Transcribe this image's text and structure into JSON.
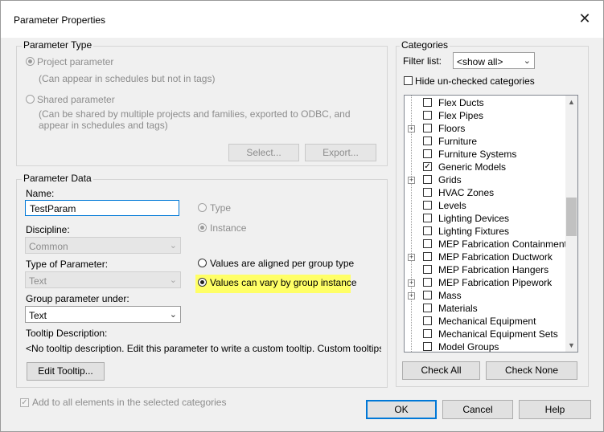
{
  "window": {
    "title": "Parameter Properties",
    "close_glyph": "✕"
  },
  "parameter_type": {
    "legend": "Parameter Type",
    "project_label": "Project parameter",
    "project_desc": "(Can appear in schedules but not in tags)",
    "shared_label": "Shared parameter",
    "shared_desc_1": "(Can be shared by multiple projects and families, exported to ODBC, and",
    "shared_desc_2": "appear in schedules and tags)",
    "select_btn": "Select...",
    "export_btn": "Export..."
  },
  "parameter_data": {
    "legend": "Parameter Data",
    "name_label": "Name:",
    "name_value": "TestParam",
    "discipline_label": "Discipline:",
    "discipline_value": "Common",
    "type_label": "Type of Parameter:",
    "type_value": "Text",
    "group_label": "Group parameter under:",
    "group_value": "Text",
    "radio_type": "Type",
    "radio_instance": "Instance",
    "radio_aligned": "Values are aligned per group type",
    "radio_vary": "Values can vary by group instance",
    "tooltip_label": "Tooltip Description:",
    "tooltip_text": "<No tooltip description. Edit this parameter to write a custom tooltip. Custom tooltips hav...",
    "edit_tooltip_btn": "Edit Tooltip..."
  },
  "add_all_label": "Add to all elements in the selected categories",
  "categories": {
    "legend": "Categories",
    "filter_label": "Filter list:",
    "filter_value": "<show all>",
    "hide_label": "Hide un-checked categories",
    "items": [
      {
        "label": "Flex Ducts",
        "expandable": false,
        "checked": false
      },
      {
        "label": "Flex Pipes",
        "expandable": false,
        "checked": false
      },
      {
        "label": "Floors",
        "expandable": true,
        "checked": false
      },
      {
        "label": "Furniture",
        "expandable": false,
        "checked": false
      },
      {
        "label": "Furniture Systems",
        "expandable": false,
        "checked": false
      },
      {
        "label": "Generic Models",
        "expandable": false,
        "checked": true
      },
      {
        "label": "Grids",
        "expandable": true,
        "checked": false
      },
      {
        "label": "HVAC Zones",
        "expandable": false,
        "checked": false
      },
      {
        "label": "Levels",
        "expandable": false,
        "checked": false
      },
      {
        "label": "Lighting Devices",
        "expandable": false,
        "checked": false
      },
      {
        "label": "Lighting Fixtures",
        "expandable": false,
        "checked": false
      },
      {
        "label": "MEP Fabrication Containment",
        "expandable": false,
        "checked": false
      },
      {
        "label": "MEP Fabrication Ductwork",
        "expandable": true,
        "checked": false
      },
      {
        "label": "MEP Fabrication Hangers",
        "expandable": false,
        "checked": false
      },
      {
        "label": "MEP Fabrication Pipework",
        "expandable": true,
        "checked": false
      },
      {
        "label": "Mass",
        "expandable": true,
        "checked": false
      },
      {
        "label": "Materials",
        "expandable": false,
        "checked": false
      },
      {
        "label": "Mechanical Equipment",
        "expandable": false,
        "checked": false
      },
      {
        "label": "Mechanical Equipment Sets",
        "expandable": false,
        "checked": false
      },
      {
        "label": "Model Groups",
        "expandable": false,
        "checked": false
      }
    ],
    "check_all_btn": "Check All",
    "check_none_btn": "Check None"
  },
  "buttons": {
    "ok": "OK",
    "cancel": "Cancel",
    "help": "Help"
  },
  "colors": {
    "highlight": "#ffff66",
    "focus_border": "#0078d7"
  }
}
